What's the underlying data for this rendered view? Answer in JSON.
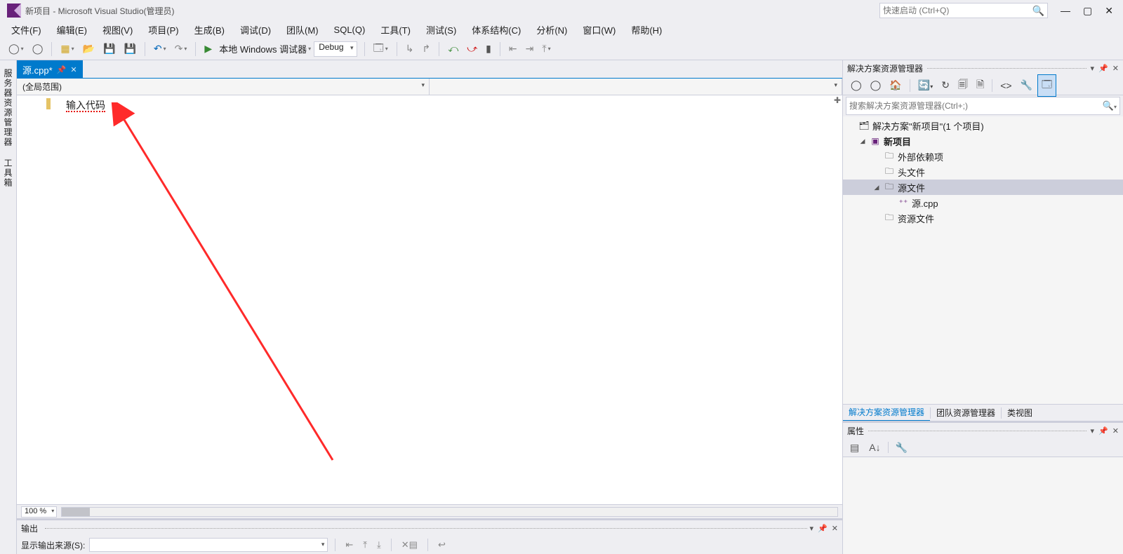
{
  "titlebar": {
    "title": "新项目 - Microsoft Visual Studio(管理员)",
    "quicklaunch_placeholder": "快速启动 (Ctrl+Q)"
  },
  "menubar": {
    "items": [
      {
        "label": "文件(F)"
      },
      {
        "label": "编辑(E)"
      },
      {
        "label": "视图(V)"
      },
      {
        "label": "项目(P)"
      },
      {
        "label": "生成(B)"
      },
      {
        "label": "调试(D)"
      },
      {
        "label": "团队(M)"
      },
      {
        "label": "SQL(Q)"
      },
      {
        "label": "工具(T)"
      },
      {
        "label": "测试(S)"
      },
      {
        "label": "体系结构(C)"
      },
      {
        "label": "分析(N)"
      },
      {
        "label": "窗口(W)"
      },
      {
        "label": "帮助(H)"
      }
    ]
  },
  "toolbar": {
    "debugger_label": "本地 Windows 调试器",
    "config": "Debug"
  },
  "leftstrip": {
    "tab1": "服务器资源管理器",
    "tab2": "工具箱"
  },
  "editor": {
    "tab_label": "源.cpp*",
    "scope": "(全局范围)",
    "code_text": "输入代码",
    "zoom": "100 %"
  },
  "output": {
    "title": "输出",
    "source_label": "显示输出来源(S):"
  },
  "solution_explorer": {
    "title": "解决方案资源管理器",
    "search_placeholder": "搜索解决方案资源管理器(Ctrl+;)",
    "root": "解决方案\"新项目\"(1 个项目)",
    "project": "新项目",
    "external_deps": "外部依赖项",
    "headers": "头文件",
    "sources": "源文件",
    "source_file": "源.cpp",
    "resources": "资源文件",
    "tabs": {
      "se": "解决方案资源管理器",
      "team": "团队资源管理器",
      "class": "类视图"
    }
  },
  "properties": {
    "title": "属性"
  }
}
